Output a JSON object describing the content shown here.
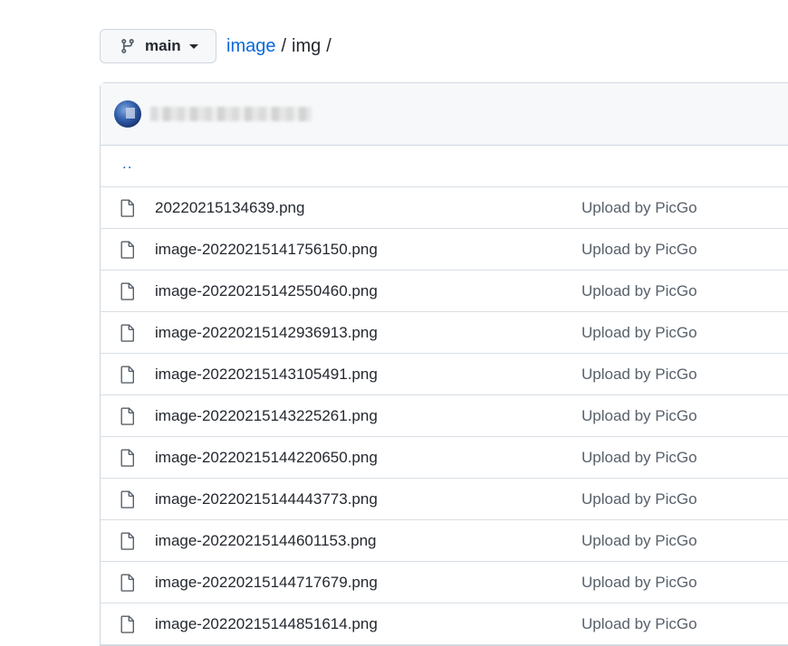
{
  "branch": {
    "label": "main",
    "icon": "git-branch-icon"
  },
  "breadcrumb": {
    "repo": "image",
    "separator": "/",
    "folder": "img",
    "trailing": "/"
  },
  "parent_dir": "..",
  "files": [
    {
      "name": "20220215134639.png",
      "message": "Upload by PicGo"
    },
    {
      "name": "image-20220215141756150.png",
      "message": "Upload by PicGo"
    },
    {
      "name": "image-20220215142550460.png",
      "message": "Upload by PicGo"
    },
    {
      "name": "image-20220215142936913.png",
      "message": "Upload by PicGo"
    },
    {
      "name": "image-20220215143105491.png",
      "message": "Upload by PicGo"
    },
    {
      "name": "image-20220215143225261.png",
      "message": "Upload by PicGo"
    },
    {
      "name": "image-20220215144220650.png",
      "message": "Upload by PicGo"
    },
    {
      "name": "image-20220215144443773.png",
      "message": "Upload by PicGo"
    },
    {
      "name": "image-20220215144601153.png",
      "message": "Upload by PicGo"
    },
    {
      "name": "image-20220215144717679.png",
      "message": "Upload by PicGo"
    },
    {
      "name": "image-20220215144851614.png",
      "message": "Upload by PicGo"
    }
  ],
  "colors": {
    "link": "#0969da",
    "muted": "#57606a",
    "border": "#d0d7de"
  }
}
